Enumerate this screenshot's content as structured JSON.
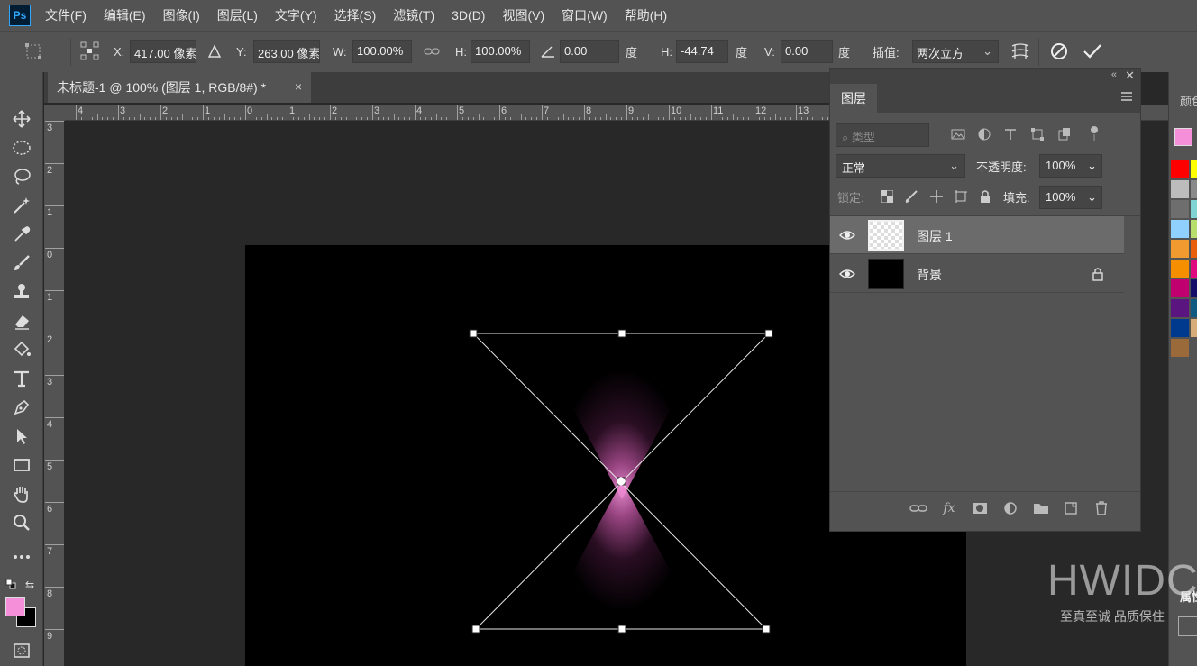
{
  "app": {
    "logo_text": "Ps"
  },
  "menu": [
    "文件(F)",
    "编辑(E)",
    "图像(I)",
    "图层(L)",
    "文字(Y)",
    "选择(S)",
    "滤镜(T)",
    "3D(D)",
    "视图(V)",
    "窗口(W)",
    "帮助(H)"
  ],
  "options_bar": {
    "x_label": "X:",
    "x_value": "417.00 像素",
    "y_label": "Y:",
    "y_value": "263.00 像素",
    "w_label": "W:",
    "w_value": "100.00%",
    "h_label": "H:",
    "h_value": "100.00%",
    "angle_value": "0.00",
    "angle_unit": "度",
    "hskew_label": "H:",
    "hskew_value": "-44.74",
    "hskew_unit": "度",
    "vskew_label": "V:",
    "vskew_value": "0.00",
    "vskew_unit": "度",
    "interp_label": "插值:",
    "interp_value": "两次立方"
  },
  "document_tab": {
    "title": "未标题-1 @ 100% (图层 1, RGB/8#) *",
    "close": "×"
  },
  "ruler": {
    "h_labels": [
      "4",
      "3",
      "2",
      "1",
      "0",
      "1",
      "2",
      "3",
      "4",
      "5",
      "6",
      "7",
      "8",
      "9",
      "10",
      "11",
      "12",
      "13"
    ],
    "v_labels": [
      "3",
      "2",
      "1",
      "0",
      "1",
      "2",
      "3",
      "4",
      "5",
      "6",
      "7",
      "8",
      "9"
    ]
  },
  "layers_panel": {
    "tab": "图层",
    "filter_placeholder": "类型",
    "blend_mode": "正常",
    "opacity_label": "不透明度:",
    "opacity_value": "100%",
    "lock_label": "锁定:",
    "fill_label": "填充:",
    "fill_value": "100%",
    "layers": [
      {
        "name": "图层 1",
        "selected": true
      },
      {
        "name": "背景",
        "selected": false,
        "locked": true
      }
    ]
  },
  "right_dock": {
    "panel_label": "颜色",
    "props_label": "属性"
  },
  "colors": {
    "foreground": "#f58fd9",
    "background": "#000000",
    "swatches": [
      "#ff0000",
      "#ffff00",
      "#bcbcbc",
      "#8a8a8a",
      "#6e6e6e",
      "#80d4d4",
      "#8fd0ff",
      "#b8df6c",
      "#f09a30",
      "#e8600c",
      "#f58f00",
      "#e0087e",
      "#c0006e",
      "#150f6a",
      "#5b1580",
      "#0e5a80",
      "#003a8e",
      "#d6ac78",
      "#9a6a3a"
    ]
  },
  "watermark": {
    "title": "HWIDC",
    "subtitle": "至真至诚 品质保住"
  }
}
